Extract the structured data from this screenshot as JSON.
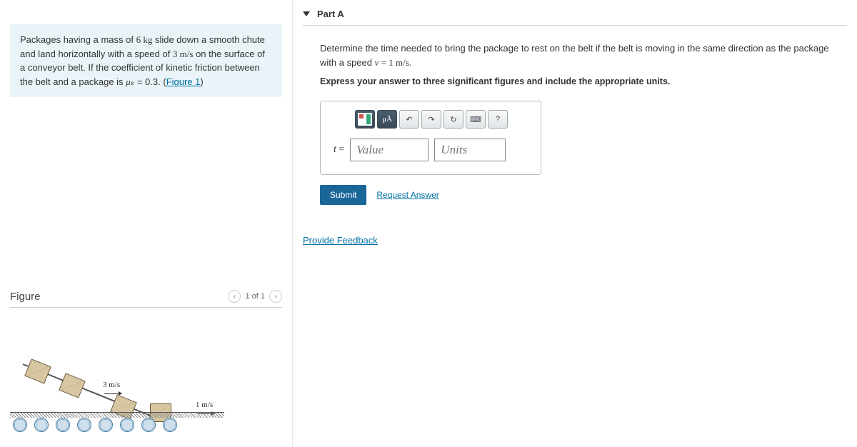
{
  "problem": {
    "text_prefix": "Packages having a mass of ",
    "mass": "6 kg",
    "text_mid1": " slide down a smooth chute and land horizontally with a speed of ",
    "land_speed": "3 m/s",
    "text_mid2": " on the surface of a conveyor belt. If the coefficient of kinetic friction between the belt and a package is ",
    "mu_symbol": "μₖ",
    "mu_eq": " = 0.3. (",
    "figure_link": "Figure 1",
    "close_paren": ")"
  },
  "figure": {
    "title": "Figure",
    "counter": "1 of 1",
    "chute_speed": "3 m/s",
    "belt_speed": "1 m/s"
  },
  "part": {
    "label": "Part A",
    "prompt_prefix": "Determine the time needed to bring the package to rest on the belt if the belt is moving in the same direction as the package with a speed ",
    "prompt_v": "v",
    "prompt_val": " = 1 m/s.",
    "instruction": "Express your answer to three significant figures and include the appropriate units.",
    "variable": "t",
    "equals": " = ",
    "value_placeholder": "Value",
    "units_placeholder": "Units",
    "submit": "Submit",
    "request": "Request Answer",
    "toolbar": {
      "mu": "μÅ",
      "undo": "↶",
      "redo": "↷",
      "reset": "↻",
      "kb": "⌨",
      "help": "?"
    }
  },
  "feedback_link": "Provide Feedback"
}
